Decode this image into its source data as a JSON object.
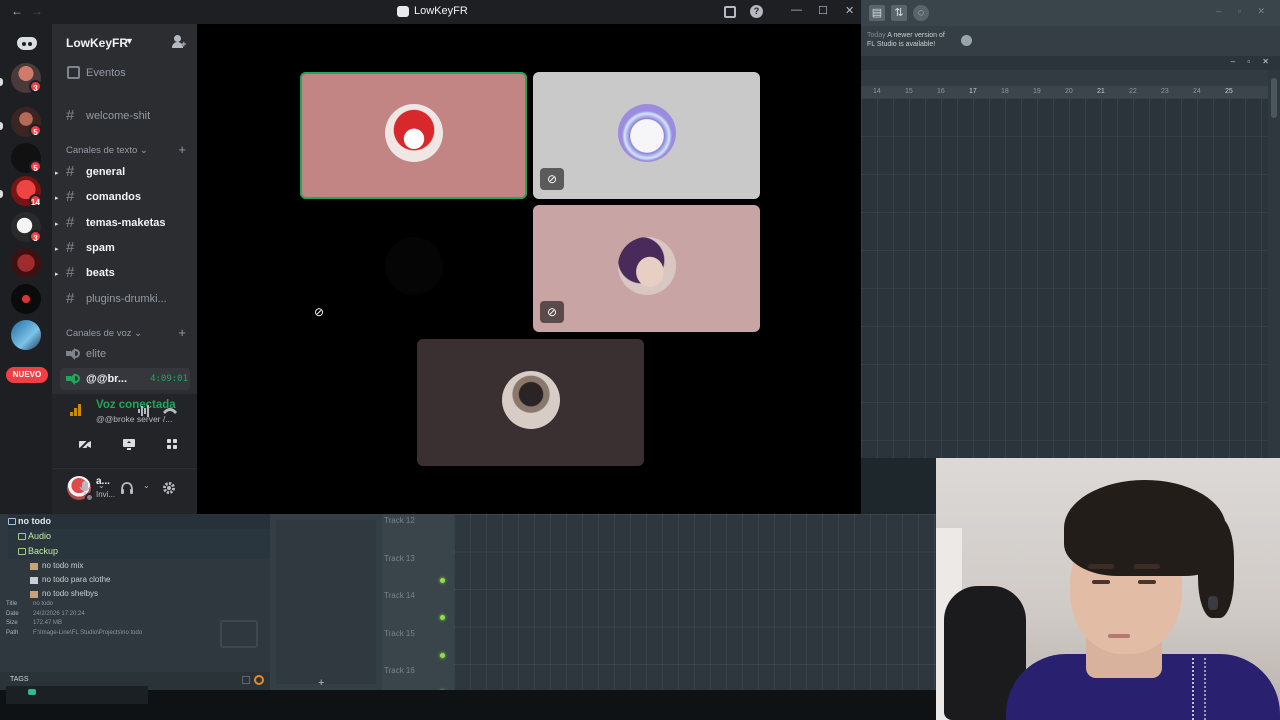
{
  "window": {
    "title": "LowKeyFR"
  },
  "colors": {
    "accent_green": "#23a55a",
    "danger_red": "#f23f43",
    "sidebar_bg": "#2b2d31",
    "rail_bg": "#1e1f22",
    "fl_accent": "#8ce04b"
  },
  "rail": {
    "servers": [
      {
        "badge": "3"
      },
      {
        "badge": "5"
      },
      {
        "badge": "5"
      },
      {
        "badge": "14"
      },
      {
        "badge": "3"
      },
      {
        "badge": ""
      },
      {
        "badge": ""
      },
      {
        "badge": ""
      }
    ],
    "new_label": "NUEVO"
  },
  "guild": {
    "name": "LowKeyFR",
    "events_label": "Eventos",
    "welcome_channel": "welcome-shit",
    "text_category": "Canales de texto",
    "text_channels": [
      {
        "name": "general",
        "unread": true
      },
      {
        "name": "comandos",
        "unread": true
      },
      {
        "name": "temas-maketas",
        "unread": true
      },
      {
        "name": "spam",
        "unread": true
      },
      {
        "name": "beats",
        "unread": true
      },
      {
        "name": "plugins-drumki...",
        "unread": false
      }
    ],
    "voice_category": "Canales de voz",
    "voice_channels": [
      {
        "name": "elite",
        "active": false,
        "timer": ""
      },
      {
        "name": "@@br...",
        "active": true,
        "timer": "4:09:01"
      }
    ]
  },
  "voice_panel": {
    "title": "Voz conectada",
    "subtitle": "@@broke server /..."
  },
  "user_panel": {
    "name": "a...",
    "status": "Invi..."
  },
  "stage": {
    "tiles": [
      {
        "speaking": true,
        "muted": false,
        "bg": "#c28584",
        "avatar": "red-mask"
      },
      {
        "speaking": false,
        "muted": true,
        "bg": "#c9c9ca",
        "avatar": "white-cat"
      },
      {
        "speaking": false,
        "muted": true,
        "bg": "#000000",
        "avatar": "none"
      },
      {
        "speaking": false,
        "muted": true,
        "bg": "#c8a4a5",
        "avatar": "girl"
      },
      {
        "speaking": false,
        "muted": false,
        "bg": "#3a2f31",
        "avatar": "hooded"
      }
    ]
  },
  "fl_studio": {
    "hint": {
      "prefix": "Today",
      "line1": "A newer version of",
      "line2": "FL Studio is available!"
    },
    "ruler": [
      "14",
      "15",
      "16",
      "17",
      "18",
      "19",
      "20",
      "21",
      "22",
      "23",
      "24",
      "25"
    ],
    "browser": {
      "root": "no todo",
      "folders": [
        "Audio",
        "Backup"
      ],
      "files": [
        "no todo mix",
        "no todo para clothe",
        "no todo shelbys"
      ],
      "meta": [
        {
          "key": "Title",
          "value": "no todo"
        },
        {
          "key": "Date",
          "value": "24/2/2026 17:20:24"
        },
        {
          "key": "Size",
          "value": "172.47 MB"
        },
        {
          "key": "Path",
          "value": "F:\\Image-Line\\FL Studio\\Projects\\no todo"
        }
      ],
      "tags_label": "TAGS"
    },
    "tracks": [
      "Track 12",
      "Track 13",
      "Track 14",
      "Track 15",
      "Track 16"
    ]
  }
}
